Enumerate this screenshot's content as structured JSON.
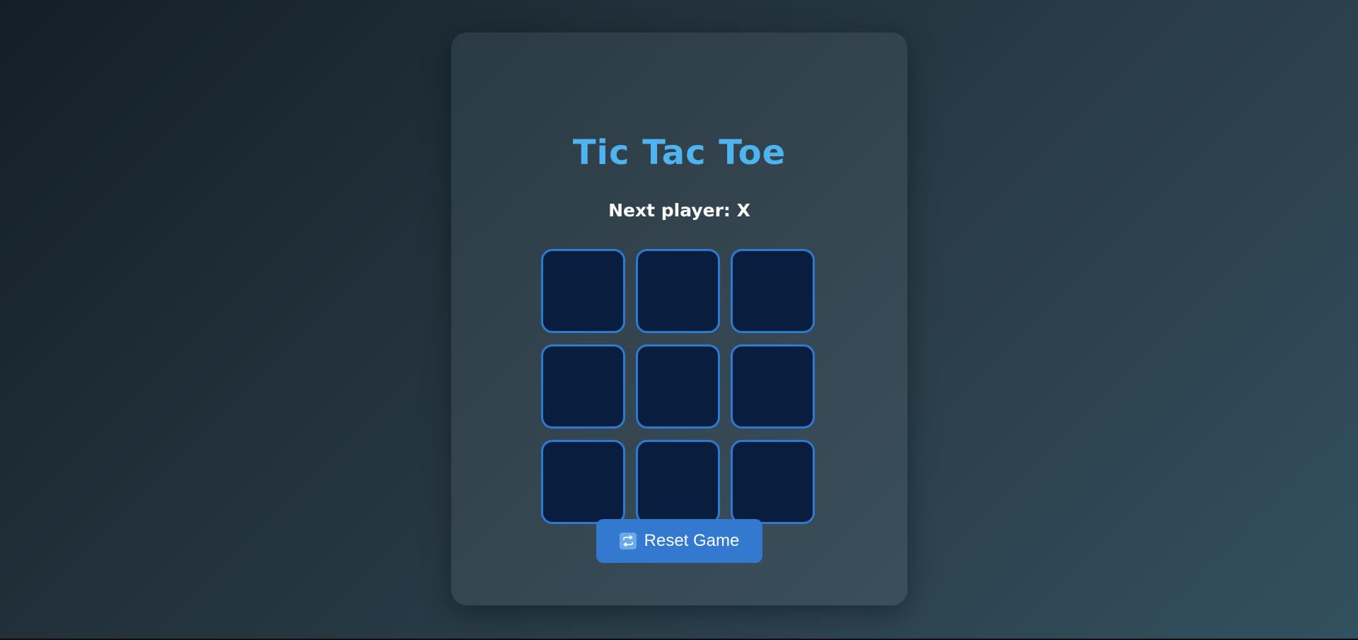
{
  "game": {
    "title": "Tic Tac Toe",
    "status": "Next player: X",
    "board": [
      "",
      "",
      "",
      "",
      "",
      "",
      "",
      "",
      ""
    ],
    "reset_label": "Reset Game",
    "reset_icon": "repeat-icon"
  },
  "colors": {
    "title": "#4fb3ef",
    "cell_border": "#2f7ad1",
    "cell_fill": "#091d3e",
    "button": "#3379cf"
  }
}
